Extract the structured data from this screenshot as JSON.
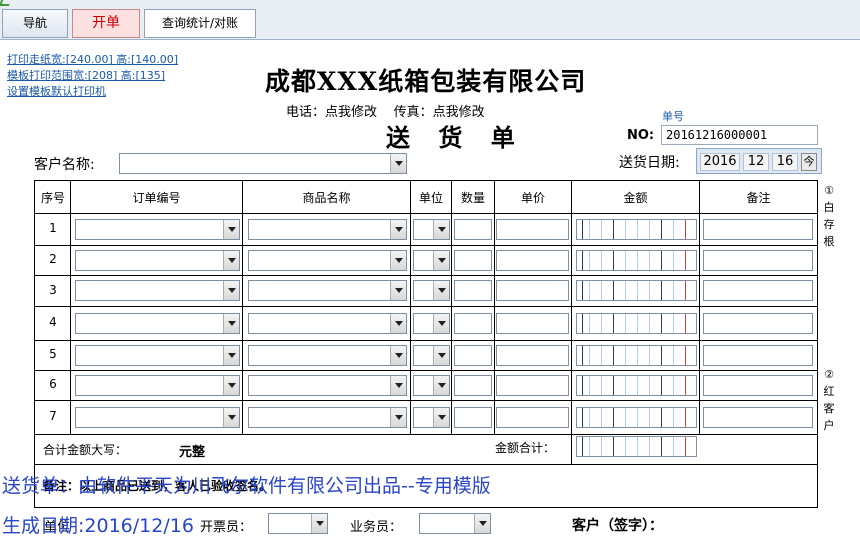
{
  "tabs": [
    {
      "label": "导航"
    },
    {
      "label": "开单"
    },
    {
      "label": "查询统计/对账"
    }
  ],
  "print_links": [
    "打印走纸宽:[240.00] 高:[140.00]",
    "模板打印范围宽:[208] 高:[135]",
    "设置模板默认打印机"
  ],
  "company_title": "成都XXX纸箱包装有限公司",
  "contact": {
    "phone_label": "电话：",
    "phone_value": "点我修改",
    "fax_label": "传真：",
    "fax_value": "点我修改"
  },
  "doc_title": "送 货 单",
  "order_no": {
    "caption": "单号",
    "label": "NO:",
    "value": "20161216000001"
  },
  "delivery_date": {
    "label": "送货日期:",
    "year": "2016",
    "month": "12",
    "day": "16",
    "spin": "今"
  },
  "customer": {
    "label": "客户名称:",
    "value": ""
  },
  "table": {
    "headers": [
      "序号",
      "订单编号",
      "商品名称",
      "单位",
      "数量",
      "单价",
      "金额",
      "备注"
    ],
    "rows": [
      "1",
      "2",
      "3",
      "4",
      "5",
      "6",
      "7"
    ]
  },
  "totals": {
    "upper_label": "合计金额大写：",
    "upper_value": "元整",
    "sum_label": "金额合计："
  },
  "remarks_label": "备注：以上商品已送到，客人已验收签名。",
  "side_notes": {
    "first": "①白存根",
    "second": "②红客户"
  },
  "footer": {
    "receipt_label": "开票员：",
    "sales_label": "业务员：",
    "customer_sign": "客户（签字）：",
    "unit_label": "单位"
  },
  "overlay": {
    "line1": "送货单：由软件平天为川飞尔软件有限公司出品--专用模版",
    "line2": "生成日期:2016/12/16"
  },
  "colors": {
    "link": "#1a5aa8",
    "overlay": "#2946c8",
    "active_tab": "#d00000"
  }
}
